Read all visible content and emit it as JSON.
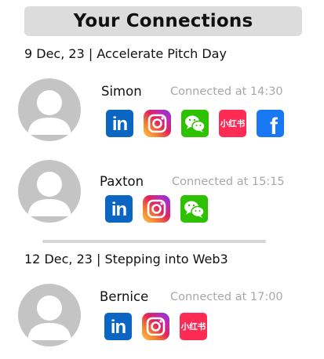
{
  "header": {
    "title": "Your Connections"
  },
  "events": [
    {
      "title": "9 Dec, 23 | Accelerate Pitch Day",
      "connections": [
        {
          "name": "Simon",
          "time": "Connected at 14:30",
          "socials": [
            "linkedin-icon",
            "instagram-icon",
            "wechat-icon",
            "xiaohongshu-icon",
            "facebook-icon"
          ]
        },
        {
          "name": "Paxton",
          "time": "Connected at 15:15",
          "socials": [
            "linkedin-icon",
            "instagram-icon",
            "wechat-icon"
          ]
        }
      ]
    },
    {
      "title": "12 Dec, 23 | Stepping into Web3",
      "connections": [
        {
          "name": "Bernice",
          "time": "Connected at 17:00",
          "socials": [
            "linkedin-icon",
            "instagram-icon",
            "xiaohongshu-icon"
          ]
        }
      ]
    }
  ],
  "icons": {
    "linkedin": "in",
    "xiaohongshu": "小红书",
    "facebook": "f"
  },
  "colors": {
    "header_bg": "#dcdcdc",
    "avatar": "#c4c4c4",
    "muted_text": "#a8a8a8",
    "linkedin": "#0a66c2",
    "wechat": "#2dc100",
    "xiaohongshu": "#fe2c55",
    "facebook": "#1877f2"
  }
}
